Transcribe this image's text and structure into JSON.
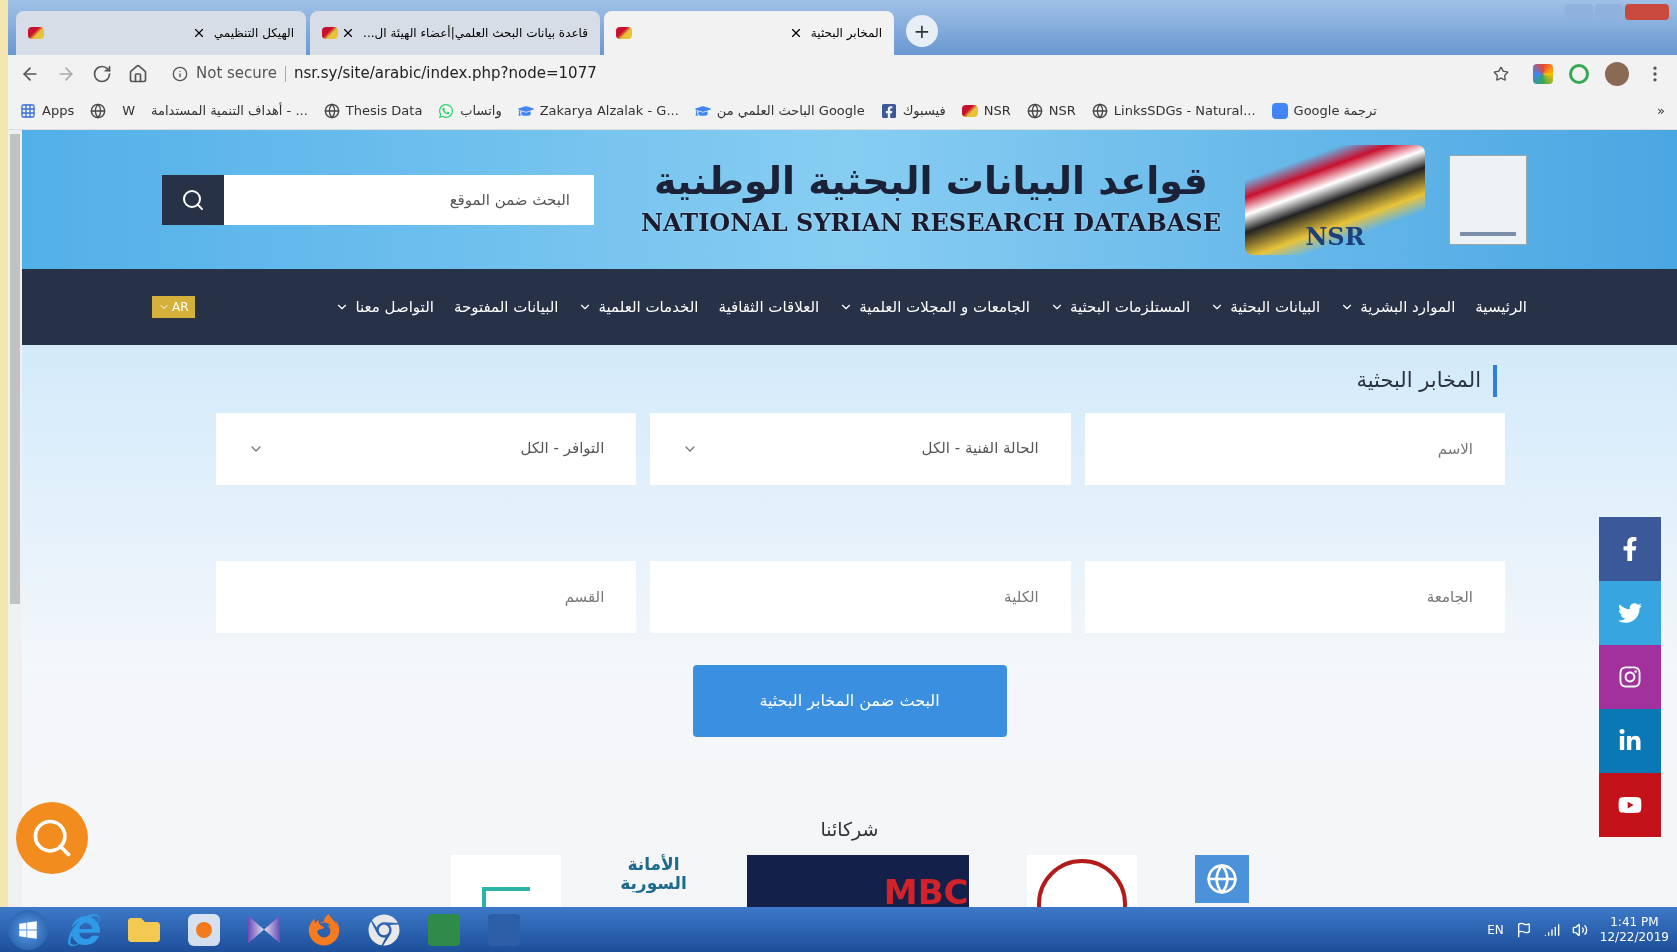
{
  "browser": {
    "tabs": [
      {
        "title": "المخابر البحثية",
        "selected": true
      },
      {
        "title": "قاعدة بيانات البحث العلمي|أعضاء الهيئة ال...",
        "selected": false
      },
      {
        "title": "الهيكل التنظيمي",
        "selected": false
      }
    ],
    "new_tab": "+",
    "address_bar": {
      "security": "Not secure",
      "url": "nsr.sy/site/arabic/index.php?node=1077"
    },
    "bookmarks": [
      {
        "kind": "translate",
        "label": "Google ترجمة"
      },
      {
        "kind": "globe",
        "label": "LinksSDGs - Natural..."
      },
      {
        "kind": "globe",
        "label": "NSR"
      },
      {
        "kind": "nsr",
        "label": "NSR"
      },
      {
        "kind": "facebook",
        "label": "فيسبوك"
      },
      {
        "kind": "scholar",
        "label": "الباحث العلمي من Google"
      },
      {
        "kind": "scholar",
        "label": "Zakarya Alzalak - G..."
      },
      {
        "kind": "whatsapp",
        "label": "واتساب"
      },
      {
        "kind": "globe",
        "label": "Thesis Data"
      },
      {
        "kind": "text",
        "label": "أهداف التنمية المستدامة - ..."
      },
      {
        "kind": "wiki",
        "label": "W"
      },
      {
        "kind": "globe"
      },
      {
        "kind": "apps",
        "label": "Apps"
      }
    ],
    "bookmarks_more": "»"
  },
  "header": {
    "search": {
      "placeholder": "البحث ضمن الموقع"
    },
    "title": "قواعد البيانات البحثية الوطنية",
    "subtitle": "NATIONAL SYRIAN RESEARCH DATABASE",
    "logo_text": "NSR"
  },
  "nav": {
    "items": [
      {
        "label": "الرئيسية",
        "dropdown": false
      },
      {
        "label": "الموارد البشرية",
        "dropdown": true
      },
      {
        "label": "البيانات البحثية",
        "dropdown": true
      },
      {
        "label": "المستلزمات البحثية",
        "dropdown": true
      },
      {
        "label": "الجامعات و المجلات العلمية",
        "dropdown": true
      },
      {
        "label": "العلاقات الثقافية",
        "dropdown": false
      },
      {
        "label": "الخدمات العلمية",
        "dropdown": true
      },
      {
        "label": "البيانات المفتوحة",
        "dropdown": false
      },
      {
        "label": "التواصل معنا",
        "dropdown": true
      }
    ],
    "language": "AR"
  },
  "content": {
    "heading": "المخابر البحثية",
    "fields": [
      {
        "kind": "input",
        "placeholder": "الاسم"
      },
      {
        "kind": "select",
        "value": "الحالة الفنية - الكل"
      },
      {
        "kind": "select",
        "value": "التوافر - الكل"
      },
      {
        "kind": "input",
        "placeholder": "الجامعة"
      },
      {
        "kind": "input",
        "placeholder": "الكلية"
      },
      {
        "kind": "input",
        "placeholder": "القسم"
      }
    ],
    "search_button": "البحث ضمن المخابر البحثية",
    "partners": {
      "heading": "شركائنا",
      "logos": [
        {
          "kind": "un"
        },
        {
          "kind": "university"
        },
        {
          "kind": "mbc",
          "text": "MBC"
        },
        {
          "kind": "trust",
          "text": "الأمانة السورية"
        },
        {
          "kind": "generic"
        }
      ]
    }
  },
  "social": [
    {
      "kind": "facebook"
    },
    {
      "kind": "twitter"
    },
    {
      "kind": "instagram"
    },
    {
      "kind": "linkedin"
    },
    {
      "kind": "youtube"
    }
  ],
  "taskbar": {
    "language": "EN",
    "time": "1:41 PM",
    "date": "12/22/2019"
  }
}
